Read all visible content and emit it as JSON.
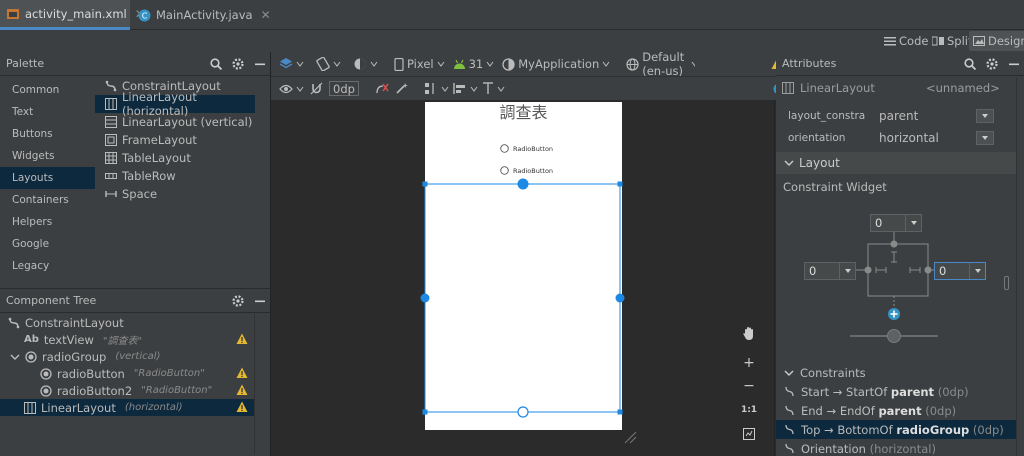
{
  "tabs": [
    {
      "label": "activity_main.xml",
      "active": true
    },
    {
      "label": "MainActivity.java",
      "active": false
    }
  ],
  "view_modes": {
    "code": "Code",
    "split": "Split",
    "design": "Design"
  },
  "palette": {
    "title": "Palette",
    "categories": [
      "Common",
      "Text",
      "Buttons",
      "Widgets",
      "Layouts",
      "Containers",
      "Helpers",
      "Google",
      "Legacy"
    ],
    "selected_category": "Layouts",
    "items": [
      "ConstraintLayout",
      "LinearLayout (horizontal)",
      "LinearLayout (vertical)",
      "FrameLayout",
      "TableLayout",
      "TableRow",
      "Space"
    ],
    "selected_item": "LinearLayout (horizontal)"
  },
  "component_tree": {
    "title": "Component Tree",
    "rows": [
      {
        "label": "ConstraintLayout",
        "hint": ""
      },
      {
        "prefix": "Ab",
        "label": "textView",
        "hint": "\"調查表\""
      },
      {
        "label": "radioGroup",
        "hint": "(vertical)"
      },
      {
        "label": "radioButton",
        "hint": "\"RadioButton\""
      },
      {
        "label": "radioButton2",
        "hint": "\"RadioButton\""
      },
      {
        "label": "LinearLayout",
        "hint": "(horizontal)"
      }
    ]
  },
  "toolbar": {
    "margin": "0dp",
    "device": "Pixel",
    "api": "31",
    "app": "MyApplication",
    "locale": "Default (en-us)"
  },
  "preview": {
    "title": "調查表",
    "radio1": "RadioButton",
    "radio2": "RadioButton"
  },
  "zoom_controls": {
    "plus": "+",
    "minus": "−",
    "one_to_one": "1:1"
  },
  "attributes": {
    "title": "Attributes",
    "component": "LinearLayout",
    "id_value": "<unnamed>",
    "rows": [
      {
        "key": "layout_constraint...",
        "value": "parent"
      },
      {
        "key": "orientation",
        "value": "horizontal"
      }
    ],
    "layout_section": "Layout",
    "constraint_widget_label": "Constraint Widget",
    "margin_top": "0",
    "margin_left": "0",
    "margin_right": "0",
    "constraints_section": "Constraints",
    "constraints": [
      {
        "name": "Start",
        "target": "StartOf",
        "ref": "parent",
        "dp": "(0dp)"
      },
      {
        "name": "End",
        "target": "EndOf",
        "ref": "parent",
        "dp": "(0dp)"
      },
      {
        "name": "Top",
        "target": "BottomOf",
        "ref": "radioGroup",
        "dp": "(0dp)"
      }
    ],
    "orientation_row": {
      "name": "Orientation",
      "value": "(horizontal)"
    }
  },
  "colors": {
    "accent": "#4a88c7",
    "selection": "#0d293e",
    "warning": "#e5b82f",
    "handle": "#1e88e5"
  }
}
